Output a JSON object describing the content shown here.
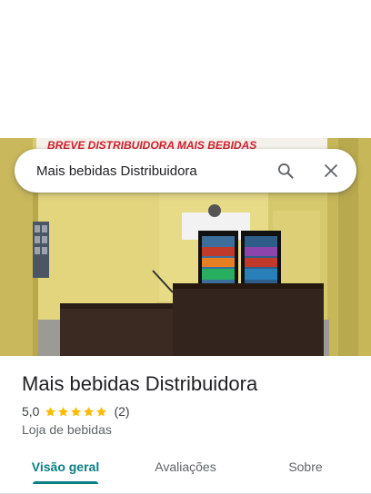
{
  "search": {
    "query": "Mais bebidas Distribuidora",
    "search_icon": "search-icon",
    "close_icon": "close-icon"
  },
  "photo": {
    "banner_text": "BREVE   DISTRIBUIDORA MAIS BEBIDAS",
    "description_icon": "place-photo"
  },
  "place": {
    "name": "Mais bebidas Distribuidora",
    "rating": "5,0",
    "stars": 5,
    "review_count": "(2)",
    "category": "Loja de bebidas"
  },
  "tabs": [
    {
      "label": "Visão geral",
      "selected": true
    },
    {
      "label": "Avaliações",
      "selected": false
    },
    {
      "label": "Sobre",
      "selected": false
    }
  ],
  "colors": {
    "accent": "#0b7f83",
    "star": "#fbbc04",
    "wall": "#e4d780",
    "counter": "#3a2a22",
    "banner_text": "#d11f2f"
  }
}
